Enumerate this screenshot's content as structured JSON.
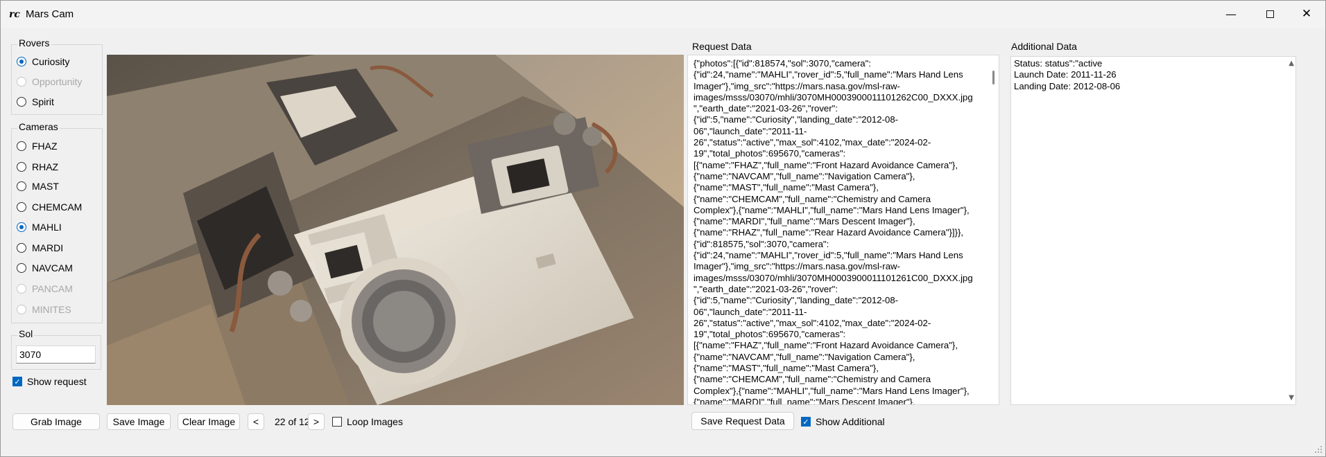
{
  "window": {
    "title": "Mars Cam",
    "icon_text": "rc"
  },
  "rovers": {
    "label": "Rovers",
    "items": [
      {
        "label": "Curiosity",
        "checked": true,
        "disabled": false
      },
      {
        "label": "Opportunity",
        "checked": false,
        "disabled": true
      },
      {
        "label": "Spirit",
        "checked": false,
        "disabled": false
      }
    ]
  },
  "cameras": {
    "label": "Cameras",
    "items": [
      {
        "label": "FHAZ",
        "checked": false,
        "disabled": false
      },
      {
        "label": "RHAZ",
        "checked": false,
        "disabled": false
      },
      {
        "label": "MAST",
        "checked": false,
        "disabled": false
      },
      {
        "label": "CHEMCAM",
        "checked": false,
        "disabled": false
      },
      {
        "label": "MAHLI",
        "checked": true,
        "disabled": false
      },
      {
        "label": "MARDI",
        "checked": false,
        "disabled": false
      },
      {
        "label": "NAVCAM",
        "checked": false,
        "disabled": false
      },
      {
        "label": "PANCAM",
        "checked": false,
        "disabled": true
      },
      {
        "label": "MINITES",
        "checked": false,
        "disabled": true
      }
    ]
  },
  "sol": {
    "label": "Sol",
    "value": "3070"
  },
  "show_request": {
    "label": "Show request",
    "checked": true
  },
  "buttons": {
    "grab_image": "Grab Image",
    "save_image": "Save Image",
    "clear_image": "Clear Image",
    "prev": "<",
    "next": ">",
    "save_request": "Save Request Data"
  },
  "paging": {
    "text": "22 of 12"
  },
  "loop_images": {
    "label": "Loop Images",
    "checked": false
  },
  "show_additional": {
    "label": "Show Additional",
    "checked": true
  },
  "request_panel": {
    "label": "Request Data",
    "text": "{\"photos\":[{\"id\":818574,\"sol\":3070,\"camera\":\n{\"id\":24,\"name\":\"MAHLI\",\"rover_id\":5,\"full_name\":\"Mars Hand Lens\nImager\"},\"img_src\":\"https://mars.nasa.gov/msl-raw-\nimages/msss/03070/mhli/3070MH0003900011101262C00_DXXX.jpg\n\",\"earth_date\":\"2021-03-26\",\"rover\":\n{\"id\":5,\"name\":\"Curiosity\",\"landing_date\":\"2012-08-\n06\",\"launch_date\":\"2011-11-\n26\",\"status\":\"active\",\"max_sol\":4102,\"max_date\":\"2024-02-\n19\",\"total_photos\":695670,\"cameras\":\n[{\"name\":\"FHAZ\",\"full_name\":\"Front Hazard Avoidance Camera\"},\n{\"name\":\"NAVCAM\",\"full_name\":\"Navigation Camera\"},\n{\"name\":\"MAST\",\"full_name\":\"Mast Camera\"},\n{\"name\":\"CHEMCAM\",\"full_name\":\"Chemistry and Camera\nComplex\"},{\"name\":\"MAHLI\",\"full_name\":\"Mars Hand Lens Imager\"},\n{\"name\":\"MARDI\",\"full_name\":\"Mars Descent Imager\"},\n{\"name\":\"RHAZ\",\"full_name\":\"Rear Hazard Avoidance Camera\"}]}},\n{\"id\":818575,\"sol\":3070,\"camera\":\n{\"id\":24,\"name\":\"MAHLI\",\"rover_id\":5,\"full_name\":\"Mars Hand Lens\nImager\"},\"img_src\":\"https://mars.nasa.gov/msl-raw-\nimages/msss/03070/mhli/3070MH0003900011101261C00_DXXX.jpg\n\",\"earth_date\":\"2021-03-26\",\"rover\":\n{\"id\":5,\"name\":\"Curiosity\",\"landing_date\":\"2012-08-\n06\",\"launch_date\":\"2011-11-\n26\",\"status\":\"active\",\"max_sol\":4102,\"max_date\":\"2024-02-\n19\",\"total_photos\":695670,\"cameras\":\n[{\"name\":\"FHAZ\",\"full_name\":\"Front Hazard Avoidance Camera\"},\n{\"name\":\"NAVCAM\",\"full_name\":\"Navigation Camera\"},\n{\"name\":\"MAST\",\"full_name\":\"Mast Camera\"},\n{\"name\":\"CHEMCAM\",\"full_name\":\"Chemistry and Camera\nComplex\"},{\"name\":\"MAHLI\",\"full_name\":\"Mars Hand Lens Imager\"},\n{\"name\":\"MARDI\",\"full_name\":\"Mars Descent Imager\"},"
  },
  "additional_panel": {
    "label": "Additional Data",
    "lines": [
      "Status: status\":\"active",
      "Launch Date: 2011-11-26",
      "Landing Date: 2012-08-06"
    ]
  },
  "colors": {
    "accent": "#0067c0",
    "window_bg": "#f0f0f0",
    "image_sky": "#6d6458",
    "rover_body": "#e8e2d6"
  },
  "icons": {
    "minimize": "minimize-icon",
    "maximize": "maximize-icon",
    "close": "close-icon",
    "scroll_up": "scroll-up-arrow-icon",
    "scroll_down": "scroll-down-arrow-icon",
    "resize_grip": "resize-grip-icon"
  }
}
